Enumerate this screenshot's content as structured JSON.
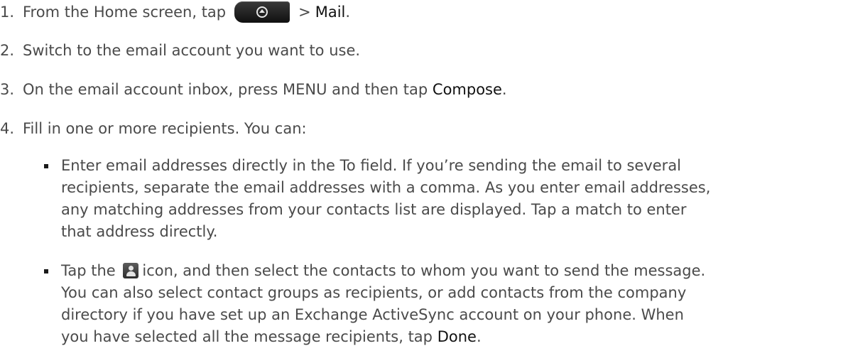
{
  "steps": [
    {
      "number": "1.",
      "text_before": "From the Home screen, tap",
      "text_after": "> ",
      "bold": "Mail",
      "end": "."
    },
    {
      "number": "2.",
      "text": "Switch to the email account you want to use."
    },
    {
      "number": "3.",
      "text_before": "On the email account inbox, press MENU and then tap ",
      "bold": "Compose",
      "end": "."
    },
    {
      "number": "4.",
      "text": "Fill in one or more recipients. You can:"
    }
  ],
  "bullets": [
    {
      "lines": [
        "Enter email addresses directly in the To field. If you’re sending the email to several",
        "recipients, separate the email addresses with a comma. As you enter email addresses,",
        "any matching addresses from your contacts list are displayed. Tap a match to enter",
        "that address directly."
      ]
    },
    {
      "line1_before": "Tap the",
      "line1_after": "icon, and then select the contacts to whom you want to send the message.",
      "lines": [
        "You can also select contact groups as recipients, or add contacts from the company",
        "directory if you have set up an Exchange ActiveSync account on your phone. When"
      ],
      "last_before": "you have selected all the message recipients, tap ",
      "last_bold": "Done",
      "last_end": "."
    }
  ],
  "icons": {
    "home": "all-apps-button-icon",
    "contact": "contact-picker-icon"
  },
  "colors": {
    "text": "#4a4a4a",
    "number": "#0a5aa0",
    "button_bg": "#1e1e1e"
  }
}
